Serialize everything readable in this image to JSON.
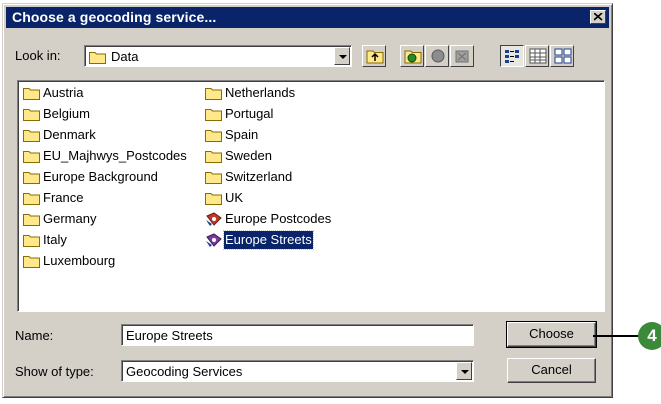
{
  "dialog": {
    "title": "Choose a geocoding service..."
  },
  "look_in": {
    "label": "Look in:",
    "value": "Data"
  },
  "files": [
    {
      "name": "Austria",
      "type": "folder"
    },
    {
      "name": "Belgium",
      "type": "folder"
    },
    {
      "name": "Denmark",
      "type": "folder"
    },
    {
      "name": "EU_Majhwys_Postcodes",
      "type": "folder"
    },
    {
      "name": "Europe Background",
      "type": "folder"
    },
    {
      "name": "France",
      "type": "folder"
    },
    {
      "name": "Germany",
      "type": "folder"
    },
    {
      "name": "Italy",
      "type": "folder"
    },
    {
      "name": "Luxembourg",
      "type": "folder"
    },
    {
      "name": "Netherlands",
      "type": "folder"
    },
    {
      "name": "Portugal",
      "type": "folder"
    },
    {
      "name": "Spain",
      "type": "folder"
    },
    {
      "name": "Sweden",
      "type": "folder"
    },
    {
      "name": "Switzerland",
      "type": "folder"
    },
    {
      "name": "UK",
      "type": "folder"
    },
    {
      "name": "Europe Postcodes",
      "type": "geocoding-service"
    },
    {
      "name": "Europe Streets",
      "type": "geocoding-service",
      "selected": true
    }
  ],
  "name_field": {
    "label": "Name:",
    "value": "Europe Streets"
  },
  "type_field": {
    "label": "Show of type:",
    "value": "Geocoding Services"
  },
  "buttons": {
    "choose": "Choose",
    "cancel": "Cancel"
  },
  "callout": {
    "number": "4",
    "color": "#3a8a3a"
  },
  "colors": {
    "titlebar": "#0a246a",
    "selection": "#0a246a",
    "face": "#d4d0c8"
  }
}
